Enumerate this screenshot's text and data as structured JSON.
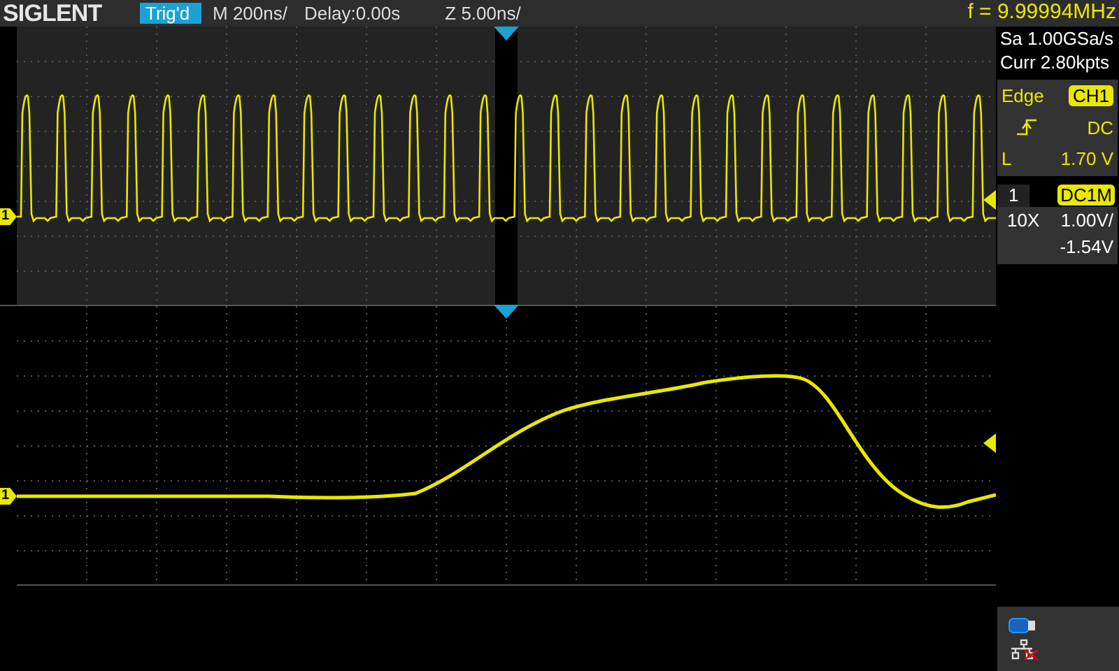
{
  "header": {
    "logo": "SIGLENT",
    "trigger_status": "Trig'd",
    "timebase": "M 200ns/",
    "delay": "Delay:0.00s",
    "zoom_timebase": "Z 5.00ns/",
    "frequency": "f = 9.99994MHz"
  },
  "channel_markers": [
    "1",
    "1"
  ],
  "acquisition": {
    "sample_rate": "Sa 1.00GSa/s",
    "memory_depth": "Curr 2.80kpts"
  },
  "trigger": {
    "type": "Edge",
    "source": "CH1",
    "coupling": "DC",
    "level_label": "L",
    "level_value": "1.70 V"
  },
  "channel": {
    "number": "1",
    "coupling": "DC1M",
    "probe": "10X",
    "scale": "1.00V/",
    "offset": "-1.54V"
  },
  "status": {
    "usb_connected": true,
    "network_connected": false
  }
}
